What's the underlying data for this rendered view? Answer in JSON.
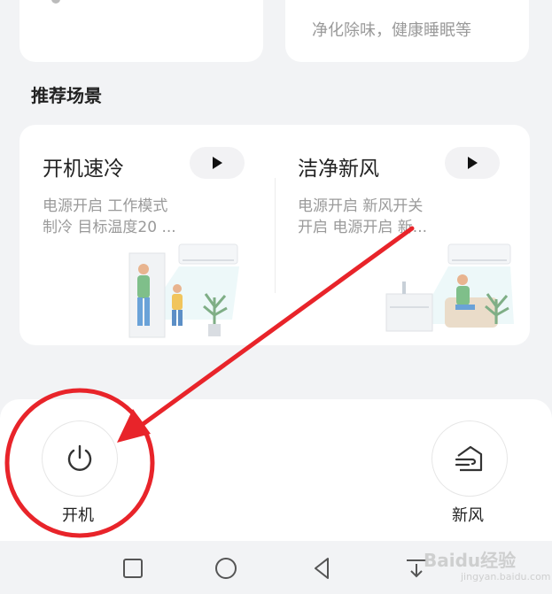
{
  "top_cards": {
    "right_subtitle": "净化除味，健康睡眠等"
  },
  "section": {
    "title": "推荐场景"
  },
  "scenes": [
    {
      "title": "开机速冷",
      "desc_line1": "电源开启 工作模式",
      "desc_line2": "制冷 目标温度20 ..."
    },
    {
      "title": "洁净新风",
      "desc_line1": "电源开启 新风开关",
      "desc_line2": "开启 电源开启 新..."
    }
  ],
  "controls": {
    "power_label": "开机",
    "fresh_air_label": "新风"
  },
  "watermark": {
    "text": "Baidu经验",
    "sub": "jingyan.baidu.com"
  },
  "colors": {
    "annotation": "#e8242a",
    "background": "#f2f3f5",
    "card": "#ffffff"
  }
}
